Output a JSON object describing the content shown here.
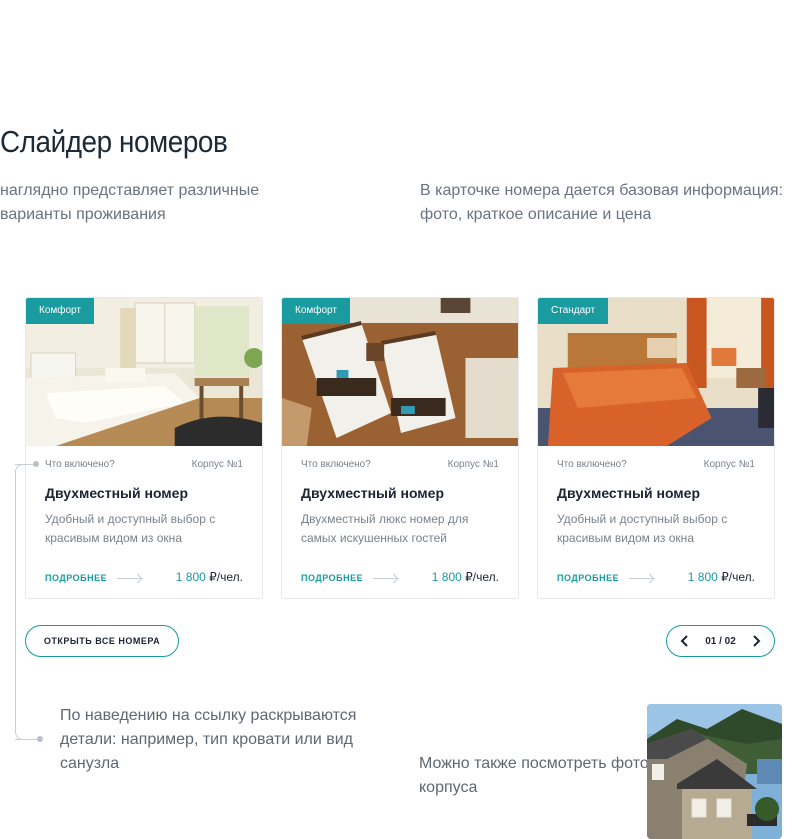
{
  "header": {
    "title": "Слайдер номеров",
    "left_description": "наглядно представляет различные варианты проживания",
    "right_description": "В карточке номера дается базовая информация: фото, краткое описание и цена"
  },
  "cards": [
    {
      "badge": "Комфорт",
      "included_label": "Что включено?",
      "building": "Корпус №1",
      "name": "Двухместный номер",
      "description": "Удобный и доступный выбор с красивым видом из окна",
      "more_label": "ПОДРОБНЕЕ",
      "price_value": "1 800",
      "price_unit": "₽/чел."
    },
    {
      "badge": "Комфорт",
      "included_label": "Что включено?",
      "building": "Корпус №1",
      "name": "Двухместный номер",
      "description": "Двухместный люкс номер для самых искушенных гостей",
      "more_label": "ПОДРОБНЕЕ",
      "price_value": "1 800",
      "price_unit": "₽/чел."
    },
    {
      "badge": "Стандарт",
      "included_label": "Что включено?",
      "building": "Корпус №1",
      "name": "Двухместный номер",
      "description": "Удобный и доступный выбор с красивым видом из окна",
      "more_label": "ПОДРОБНЕЕ",
      "price_value": "1 800",
      "price_unit": "₽/чел."
    }
  ],
  "controls": {
    "all_rooms_label": "ОТКРЫТЬ ВСЕ НОМЕРА",
    "pager_text": "01 / 02"
  },
  "notes": {
    "hover": "По наведению на ссылку раскрываются  детали: например, тип кровати или вид санузла",
    "building": "Можно также посмотреть фото корпуса"
  },
  "colors": {
    "accent": "#1a9ba0",
    "text_dark": "#1c2530",
    "text_muted": "#7a828a"
  }
}
